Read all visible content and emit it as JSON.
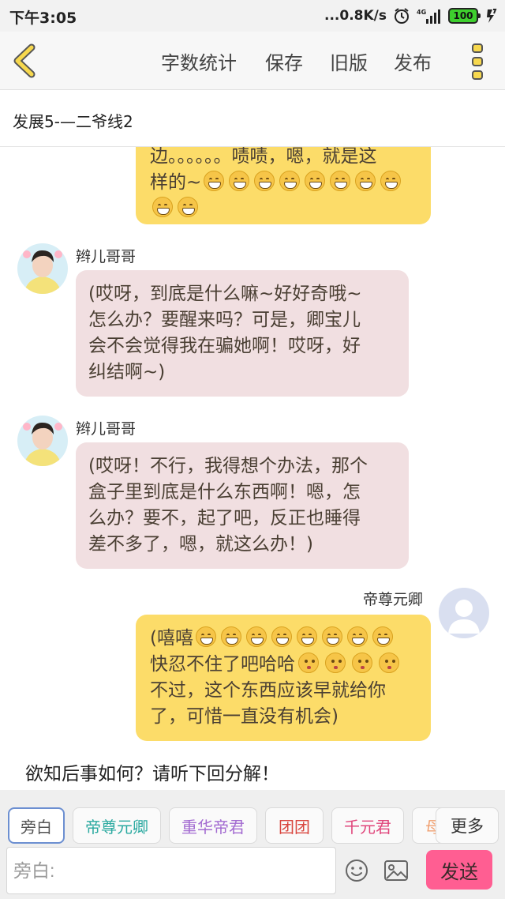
{
  "status_bar": {
    "time": "下午3:05",
    "net_speed": "...0.8K/s",
    "battery_level": "100"
  },
  "toolbar": {
    "word_count": "字数统计",
    "save": "保存",
    "old_version": "旧版",
    "publish": "发布"
  },
  "story": {
    "title": "发展5-—二爷线2"
  },
  "messages": [
    {
      "side": "right",
      "line1": "边。。。。。。啧啧，嗯，就是这",
      "line2_text": "样的~",
      "grin_count": 10
    },
    {
      "side": "left",
      "sender": "辫儿哥哥",
      "lines": [
        "(哎呀，到底是什么嘛~好好奇哦~",
        "怎么办？要醒来吗？可是，卿宝儿",
        "会不会觉得我在骗她啊！哎呀，好",
        "纠结啊~)"
      ]
    },
    {
      "side": "left",
      "sender": "辫儿哥哥",
      "lines": [
        "(哎呀！不行，我得想个办法，那个",
        "盒子里到底是什么东西啊！嗯，怎",
        "么办？要不，起了吧，反正也睡得",
        "差不多了，嗯，就这么办！)"
      ]
    },
    {
      "side": "right",
      "sender": "帝尊元卿",
      "line1": "(嘻嘻",
      "line2": "快忍不住了吧哈哈",
      "line3": "不过，这个东西应该早就给你",
      "line4": "了，可惜一直没有机会)"
    }
  ],
  "narration": "欲知后事如何？请听下回分解！",
  "roles": {
    "items": [
      {
        "label": "旁白",
        "color": "#555555"
      },
      {
        "label": "帝尊元卿",
        "color": "#2aa9a0"
      },
      {
        "label": "重华帝君",
        "color": "#a36bd1"
      },
      {
        "label": "团团",
        "color": "#d9463f"
      },
      {
        "label": "千元君",
        "color": "#e0457b"
      },
      {
        "label": "母",
        "color": "#f0a070"
      }
    ],
    "more": "更多"
  },
  "input": {
    "placeholder": "旁白:",
    "value": "",
    "send": "发送"
  }
}
